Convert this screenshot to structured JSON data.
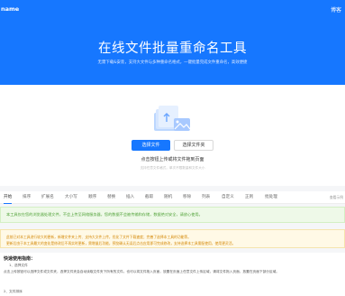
{
  "header": {
    "brand": "name",
    "lang": "博客",
    "title": "在线文件批量重命名工具",
    "subtitle": "无需下载&安装，支持大文件与多种重命名格式，一键批量完成文件重命名，高效便捷"
  },
  "upload": {
    "select_files_label": "选择文件",
    "select_folder_label": "选择文件夹",
    "hint": "点击按钮上传或将文件拖到页面",
    "subhint": "支持任意文件格式，单次不限数量和文件大小"
  },
  "toolbar": {
    "tabs": [
      "开始",
      "排序",
      "扩展名",
      "大小写",
      "顺序",
      "替换",
      "插入",
      "截取",
      "随机",
      "移除",
      "列表",
      "自定义",
      "正则",
      "批处理"
    ],
    "right": "查看示例"
  },
  "notices": {
    "green": "本工具仅在您的浏览器处理文件，不会上传至网络服务器，您的数据不会被传输和存储，数据绝对安全，请放心使用。",
    "yellow_line1": "此前已对本工具进行较大的更新，新增文件夹上传、支持大文件上传，优化了文件下载速度；完善了选择本工具的功能等。",
    "yellow_line2": "更新后由于本工具最大的变化是修改后不再实时更新，需增量后功能，预览确认无误后点击应用即可完成修改，支持选择本工具需配使用，使用更灵活。"
  },
  "guide": {
    "title": "快速使用指南：",
    "step1_title": "1、选择文件",
    "step1_line1": "点击上传按钮可以选择文件或文件夹，选择文件夹会自动读取文件夹下所有的文件。也可以将文件拖入页面，放置在页面上任意文件上传区域，请将文件拖入页面，放置在页面下部分区域。",
    "step2_title": "2、文件排序"
  },
  "colors": {
    "primary": "#1677ff",
    "success_bg": "#eef9e8",
    "warning_bg": "#fff9e6",
    "warning_text": "#d48806"
  }
}
